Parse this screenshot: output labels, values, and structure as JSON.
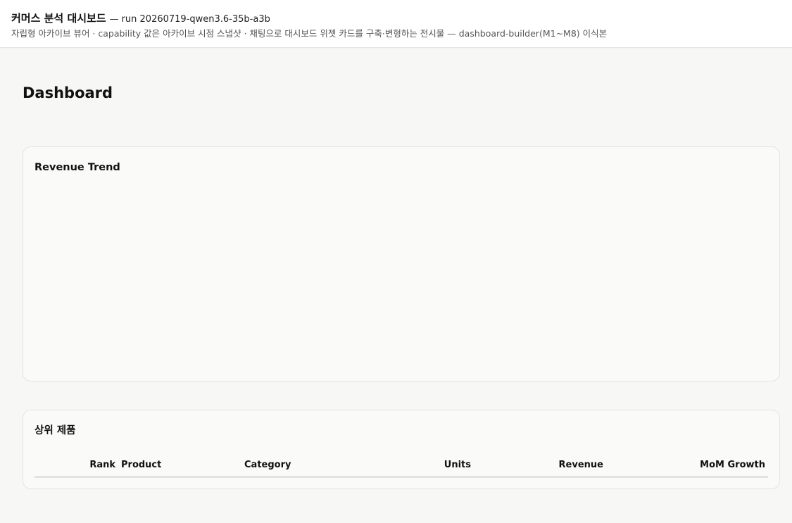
{
  "header": {
    "app_title": "커머스 분석 대시보드",
    "run_label": "— run 20260719-qwen3.6-35b-a3b",
    "subtitle": "자립형 아카이브 뷰어 · capability 값은 아카이브 시점 스냅샷 · 채팅으로 대시보드 위젯 카드를 구축·변형하는 전시물 — dashboard-builder(M1~M8) 이식본"
  },
  "page": {
    "title": "Dashboard"
  },
  "revenue_card": {
    "title": "Revenue Trend"
  },
  "products_card": {
    "title": "상위 제품",
    "columns": [
      "Rank",
      "Product",
      "Category",
      "Units",
      "Revenue",
      "MoM Growth"
    ]
  }
}
